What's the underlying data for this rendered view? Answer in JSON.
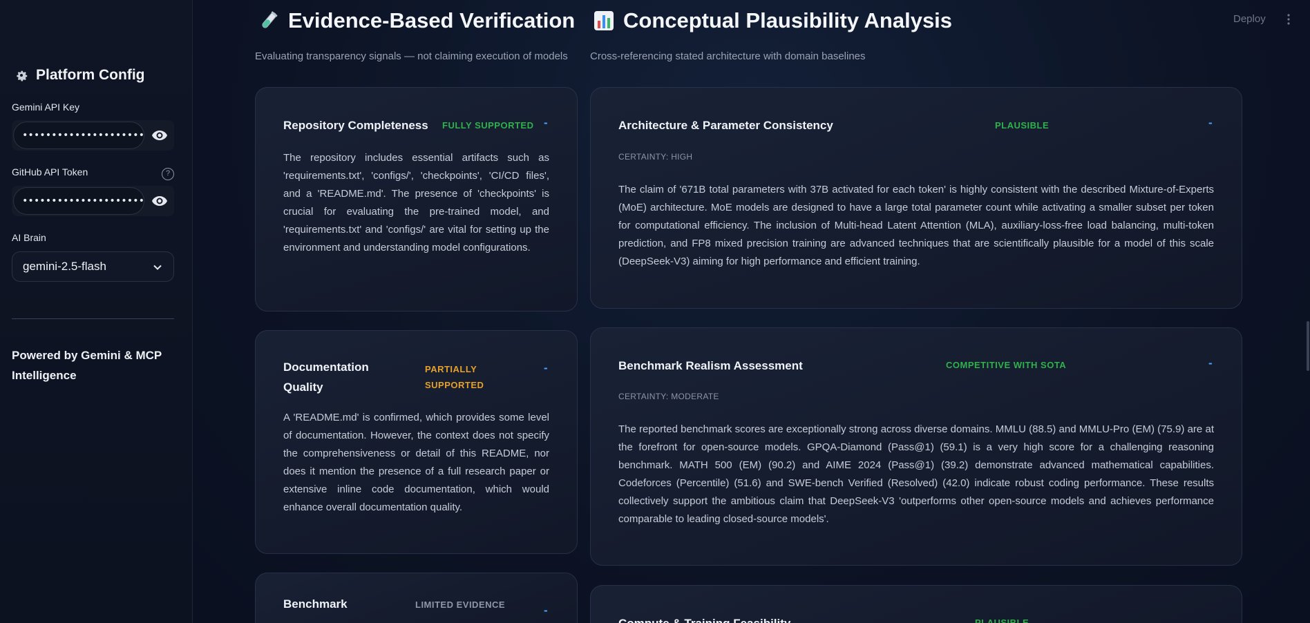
{
  "sidebar": {
    "title": "Platform Config",
    "gemini_label": "Gemini API Key",
    "gemini_value": "••••••••••••••••••••••••••••••••",
    "github_label": "GitHub API Token",
    "github_value": "••••••••••••••••••••••••••••••••",
    "help": "?",
    "brain_label": "AI Brain",
    "brain_value": "gemini-2.5-flash",
    "footer": "Powered by Gemini & MCP Intelligence"
  },
  "header": {
    "deploy": "Deploy"
  },
  "left_column": {
    "title": "Evidence-Based Verification",
    "subtitle": "Evaluating transparency signals — not claiming execution of models",
    "cards": [
      {
        "title": "Repository Completeness",
        "badge": "FULLY SUPPORTED",
        "toggle": "-",
        "body": "The repository includes essential artifacts such as 'requirements.txt', 'configs/', 'checkpoints', 'CI/CD files', and a 'README.md'. The presence of 'checkpoints' is crucial for evaluating the pre-trained model, and 'requirements.txt' and 'configs/' are vital for setting up the environment and understanding model configurations."
      },
      {
        "title": "Documentation Quality",
        "badge": "PARTIALLY SUPPORTED",
        "toggle": "-",
        "body": "A 'README.md' is confirmed, which provides some level of documentation. However, the context does not specify the comprehensiveness or detail of this README, nor does it mention the presence of a full research paper or extensive inline code documentation, which would enhance overall documentation quality."
      },
      {
        "title": "Benchmark",
        "badge": "LIMITED EVIDENCE",
        "toggle": "-"
      }
    ]
  },
  "right_column": {
    "title": "Conceptual Plausibility Analysis",
    "subtitle": "Cross-referencing stated architecture with domain baselines",
    "cards": [
      {
        "title": "Architecture & Parameter Consistency",
        "badge": "PLAUSIBLE",
        "toggle": "-",
        "certainty": "CERTAINTY: HIGH",
        "body": "The claim of '671B total parameters with 37B activated for each token' is highly consistent with the described Mixture-of-Experts (MoE) architecture. MoE models are designed to have a large total parameter count while activating a smaller subset per token for computational efficiency. The inclusion of Multi-head Latent Attention (MLA), auxiliary-loss-free load balancing, multi-token prediction, and FP8 mixed precision training are advanced techniques that are scientifically plausible for a model of this scale (DeepSeek-V3) aiming for high performance and efficient training."
      },
      {
        "title": "Benchmark Realism Assessment",
        "badge": "COMPETITIVE WITH SOTA",
        "toggle": "-",
        "certainty": "CERTAINTY: MODERATE",
        "body": "The reported benchmark scores are exceptionally strong across diverse domains. MMLU (88.5) and MMLU-Pro (EM) (75.9) are at the forefront for open-source models. GPQA-Diamond (Pass@1) (59.1) is a very high score for a challenging reasoning benchmark. MATH 500 (EM) (90.2) and AIME 2024 (Pass@1) (39.2) demonstrate advanced mathematical capabilities. Codeforces (Percentile) (51.6) and SWE-bench Verified (Resolved) (42.0) indicate robust coding performance. These results collectively support the ambitious claim that DeepSeek-V3 'outperforms other open-source models and achieves performance comparable to leading closed-source models'."
      },
      {
        "title": "Compute & Training Feasibility",
        "badge": "PLAUSIBLE",
        "toggle": "-"
      }
    ]
  }
}
